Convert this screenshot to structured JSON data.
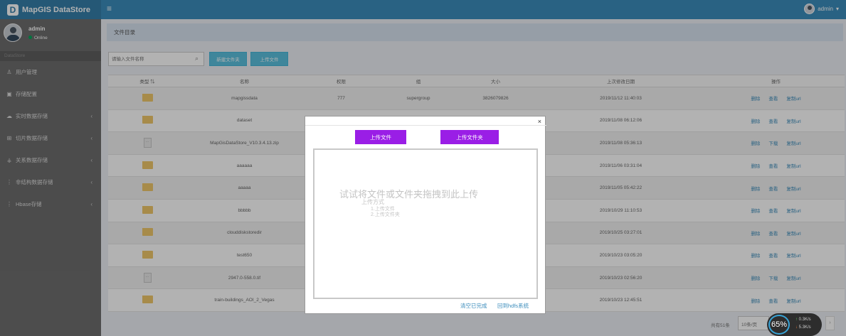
{
  "app": {
    "title": "MapGIS DataStore",
    "logo_glyph": "D",
    "menu_glyph": "≡"
  },
  "top_user": {
    "name": "admin",
    "caret": "▾"
  },
  "sidebar": {
    "user": {
      "name": "admin",
      "status": "Online"
    },
    "header": "DataStore",
    "items": [
      {
        "label": "用户管理",
        "icon": "user-icon",
        "glyph": "♙",
        "chev": ""
      },
      {
        "label": "存储配置",
        "icon": "disk-icon",
        "glyph": "▣",
        "chev": ""
      },
      {
        "label": "实时数据存储",
        "icon": "cloud-icon",
        "glyph": "☁",
        "chev": "‹"
      },
      {
        "label": "切片数据存储",
        "icon": "tiles-icon",
        "glyph": "⊞",
        "chev": "‹"
      },
      {
        "label": "关系数据存储",
        "icon": "relation-icon",
        "glyph": "⚶",
        "chev": "‹"
      },
      {
        "label": "非结构数据存储",
        "icon": "unstructured-icon",
        "glyph": "⋮",
        "chev": "‹"
      },
      {
        "label": "Hbase存储",
        "icon": "hbase-icon",
        "glyph": "⋮",
        "chev": "‹"
      }
    ]
  },
  "page": {
    "header": "文件目录"
  },
  "toolbar": {
    "search_placeholder": "请输入文件名称",
    "search_glyph": "⌕",
    "new_folder": "新建文件夹",
    "upload": "上传文件"
  },
  "table": {
    "headers": [
      "类型",
      "名称",
      "权限",
      "组",
      "大小",
      "上次修改日期",
      "操作"
    ],
    "sort_glyph": "⇅",
    "rows": [
      {
        "type": "folder",
        "name": "mapgissdata",
        "perm": "777",
        "group": "supergroup",
        "size": "3826079826",
        "date": "2019/11/12 11:40:03",
        "ops": [
          "删除",
          "查看",
          "复制url"
        ]
      },
      {
        "type": "folder",
        "name": "dataset",
        "perm": "",
        "group": "",
        "size": "",
        "date": "2019/11/08 06:12:06",
        "ops": [
          "删除",
          "查看",
          "复制url"
        ]
      },
      {
        "type": "file",
        "name": "MapGisDataStore_V10.3.4.13.zip",
        "perm": "",
        "group": "",
        "size": "",
        "date": "2019/11/08 05:36:13",
        "ops": [
          "删除",
          "下载",
          "复制url"
        ]
      },
      {
        "type": "folder",
        "name": "aaaaaa",
        "perm": "",
        "group": "",
        "size": "",
        "date": "2019/11/06 03:31:04",
        "ops": [
          "删除",
          "查看",
          "复制url"
        ]
      },
      {
        "type": "folder",
        "name": "aaaaa",
        "perm": "",
        "group": "",
        "size": "",
        "date": "2019/11/05 05:42:22",
        "ops": [
          "删除",
          "查看",
          "复制url"
        ]
      },
      {
        "type": "folder",
        "name": "bbbbb",
        "perm": "",
        "group": "",
        "size": "",
        "date": "2019/10/29 11:10:53",
        "ops": [
          "删除",
          "查看",
          "复制url"
        ]
      },
      {
        "type": "folder",
        "name": "clouddiskstoredir",
        "perm": "",
        "group": "",
        "size": "",
        "date": "2019/10/25 03:27:01",
        "ops": [
          "删除",
          "查看",
          "复制url"
        ]
      },
      {
        "type": "folder",
        "name": "test650",
        "perm": "",
        "group": "",
        "size": "",
        "date": "2019/10/23 03:05:20",
        "ops": [
          "删除",
          "查看",
          "复制url"
        ]
      },
      {
        "type": "file",
        "name": "2947.0-558.0.tif",
        "perm": "",
        "group": "",
        "size": "",
        "date": "2019/10/23 02:56:20",
        "ops": [
          "删除",
          "下载",
          "复制url"
        ]
      },
      {
        "type": "folder",
        "name": "train-buildings_AOI_2_Vegas",
        "perm": "",
        "group": "",
        "size": "",
        "date": "2019/10/23 12:45:51",
        "ops": [
          "删除",
          "查看",
          "复制url"
        ]
      }
    ]
  },
  "footer": {
    "total": "共有51条",
    "page_size": "10条/页",
    "next": "›"
  },
  "modal": {
    "close": "×",
    "upload_file": "上传文件",
    "upload_folder": "上传文件夹",
    "drop_title": "试试将文件或文件夹拖拽到此上传",
    "drop_subtitle": "上传方式",
    "drop_line1": "1.上传文件",
    "drop_line2": "2.上传文件夹",
    "clear_done": "清空已完成",
    "back_hdfs": "回到hdfs系统"
  },
  "speed_widget": {
    "percent": "65%",
    "up": "0.3K/s",
    "down": "5.3K/s",
    "up_arrow": "↑",
    "down_arrow": "↓"
  }
}
